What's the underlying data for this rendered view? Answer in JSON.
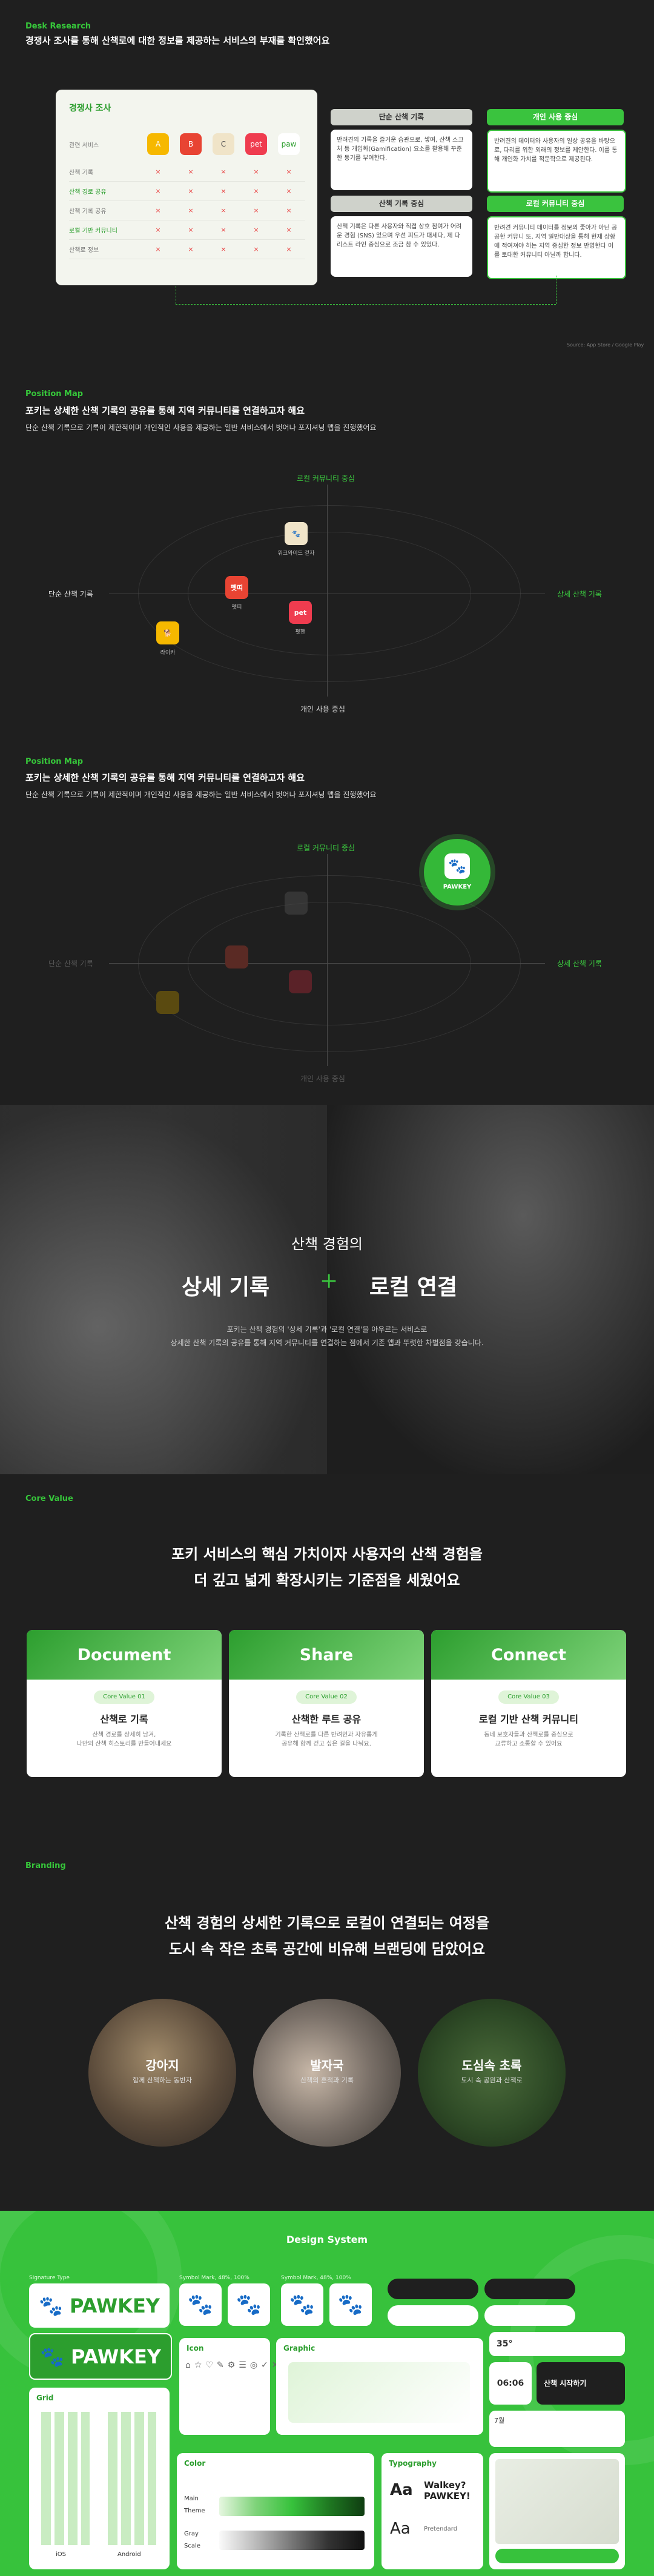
{
  "desk": {
    "tag": "Desk Research",
    "heading": "경쟁사 조사를 통해 산책로에 대한 정보를 제공하는 서비스의 부재를 확인했어요",
    "card_title": "경쟁사 조사",
    "row_labels": [
      "산책 기록",
      "산책 경로 공유",
      "산책 기록 공유",
      "로컬 기반 커뮤니티",
      "산책로 정보"
    ],
    "head_label": "관련 서비스",
    "apps": [
      "A",
      "B",
      "C",
      "pet",
      "paw"
    ],
    "marks": [
      [
        "×",
        "×",
        "×",
        "×",
        "×"
      ],
      [
        "×",
        "×",
        "×",
        "×",
        "×"
      ],
      [
        "×",
        "×",
        "×",
        "×",
        "×"
      ],
      [
        "×",
        "×",
        "×",
        "×",
        "×"
      ],
      [
        "×",
        "×",
        "×",
        "×",
        "×"
      ]
    ],
    "boxes": [
      {
        "head": "단순 산책 기록",
        "text": "반려견의 기록을 즐거운 습관으로, 쌓여, 산책 스크처 등 개입화(Gamification) 요소를 활용해 꾸준한 동기를 부여한다."
      },
      {
        "head": "개인 사용 중심",
        "text": "반려견의 데이터와 사용자의 일상 공유을 바탕으로, 다리를 위한 외래의 정보를 제안한다. 이를 통해 개인화 가치를 적문학으로 제공된다."
      },
      {
        "head": "산책 기록 중심",
        "text": "산책 기록은 다른 사용자와 직접 상호 참여가 어려운 경험 (SNS) 있으며 우선 피드가 대세다, 제 다 리스트 라인 중심으로 조금 참 수 있었다."
      },
      {
        "head": "로컬 커뮤니티 중심",
        "text": "반려견 커뮤니티 데이터를 정보의 좋아가 아닌 공 공한 커뮤니 또, 지역 일반대상을 통해 현재 상황에 적여져야 하는 지역 중심한 정보 반영한다 이를 토대한 커뮤니티 아닐까 합니다."
      }
    ],
    "footnote": "Source: App Store / Google Play"
  },
  "map1": {
    "tag": "Position Map",
    "heading": "포키는 상세한 산책 기록의 공유를 통해 지역 커뮤니티를 연결하고자 해요",
    "sub": "단순 산책 기록으로 기록이 제한적이며 개인적인 사용을 제공하는 일반 서비스에서 벗어나 포지셔닝 맵을 진행했어요",
    "top": "로컬 커뮤니티 중심",
    "bottom": "개인 사용 중심",
    "left": "단순 산책 기록",
    "right": "상세 산책 기록",
    "points": [
      {
        "name": "워크와이드 걷자",
        "icon": "🐾"
      },
      {
        "name": "펫띠",
        "icon": "펫띠"
      },
      {
        "name": "펫핸",
        "icon": "pet"
      },
      {
        "name": "라이카",
        "icon": "🐕"
      }
    ]
  },
  "map2": {
    "tag": "Position Map",
    "heading": "포키는 상세한 산책 기록의 공유를 통해 지역 커뮤니티를 연결하고자 해요",
    "sub": "단순 산책 기록으로 기록이 제한적이며 개인적인 사용을 제공하는 일반 서비스에서 벗어나 포지셔닝 맵을 진행했어요",
    "top": "로컬 커뮤니티 중심",
    "bottom": "개인 사용 중심",
    "left": "단순 산책 기록",
    "right": "상세 산책 기록",
    "brand": "PAWKEY"
  },
  "hero": {
    "small": "산책 경험의",
    "left": "상세 기록",
    "plus": "+",
    "right": "로컬 연결",
    "desc1": "포키는 산책 경험의 '상세 기록'과 '로컬 연결'을 아우르는 서비스로",
    "desc2": "상세한 산책 기록의 공유를 통해 지역 커뮤니티를 연결하는 점에서 기존 앱과 뚜렷한 차별점을 갖습니다."
  },
  "core": {
    "tag": "Core Value",
    "line1": "포키 서비스의 핵심 가치이자 사용자의 산책 경험을",
    "line2": "더 깊고 넓게 확장시키는 기준점을 세웠어요",
    "cards": [
      {
        "name": "Document",
        "pill": "Core Value 01",
        "title": "산책로 기록",
        "d1": "산책 경로를 상세히 남겨,",
        "d2": "나만의 산책 히스토리를 만들어내세요"
      },
      {
        "name": "Share",
        "pill": "Core Value 02",
        "title": "산책한 루트 공유",
        "d1": "기록한 산책로를 다른 반려인과 자유롭게",
        "d2": "공유해 함께 걷고 싶은 길을 나눠요."
      },
      {
        "name": "Connect",
        "pill": "Core Value 03",
        "title": "로컬 기반 산책 커뮤니티",
        "d1": "동네 보호자들과 산책로를 중심으로",
        "d2": "교류하고 소통할 수 있어요"
      }
    ]
  },
  "branding": {
    "tag": "Branding",
    "line1": "산책 경험의 상세한 기록으로 로컬이 연결되는 여정을",
    "line2": "도시 속 작은 초록 공간에 비유해 브랜딩에 담았어요",
    "circles": [
      {
        "title": "강아지",
        "desc": "함께 산책하는 동반자"
      },
      {
        "title": "발자국",
        "desc": "산책의 흔적과 기록"
      },
      {
        "title": "도심속 초록",
        "desc": "도시 속 공원과 산책로"
      }
    ]
  },
  "design": {
    "title": "Design System",
    "labels": {
      "logo": "Signature Type",
      "symbol1": "Symbol Mark, 48%, 100%",
      "symbol2": "Symbol Mark, 48%, 100%"
    },
    "brand": "PAWKEY",
    "panels": {
      "icon": "Icon",
      "graphic": "Graphic",
      "grid": "Grid",
      "color": "Color",
      "typo": "Typography"
    },
    "grid_labels": [
      "iOS",
      "Android"
    ],
    "color_rows": [
      "Main",
      "Theme",
      "Gray",
      "Scale"
    ],
    "typo": {
      "aa": "Aa",
      "sample": "Walkey? PAWKEY!",
      "font1": "Pretendard",
      "font2": "Pretendard"
    },
    "widget": {
      "temp": "35°",
      "time": "06:06",
      "start": "산책 시작하기",
      "month": "7월"
    }
  }
}
